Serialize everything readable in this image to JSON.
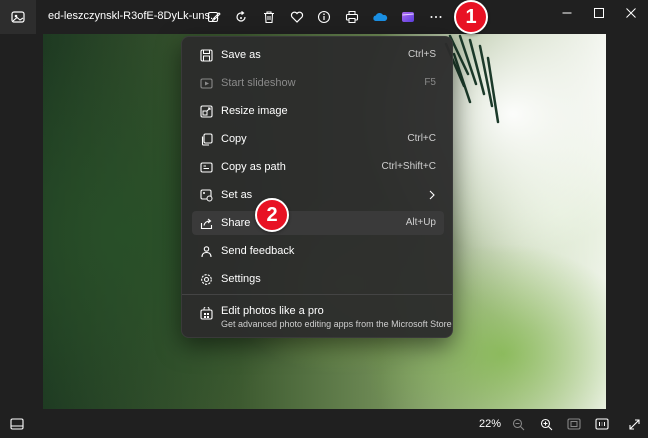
{
  "window": {
    "file_name": "ed-leszczynskl-R3ofE-8DyLk-uns..."
  },
  "toolbar": {
    "icons": [
      "edit-icon",
      "rotate-icon",
      "delete-icon",
      "favorite-icon",
      "info-icon",
      "print-icon",
      "onedrive-icon",
      "clipchamp-icon",
      "more-icon"
    ]
  },
  "menu": {
    "items": [
      {
        "label": "Save as",
        "shortcut": "Ctrl+S",
        "icon": "save-icon",
        "disabled": false
      },
      {
        "label": "Start slideshow",
        "shortcut": "F5",
        "icon": "slideshow-icon",
        "disabled": true
      },
      {
        "label": "Resize image",
        "shortcut": "",
        "icon": "resize-icon",
        "disabled": false
      },
      {
        "label": "Copy",
        "shortcut": "Ctrl+C",
        "icon": "copy-icon",
        "disabled": false
      },
      {
        "label": "Copy as path",
        "shortcut": "Ctrl+Shift+C",
        "icon": "copy-path-icon",
        "disabled": false
      },
      {
        "label": "Set as",
        "shortcut": "",
        "icon": "set-as-icon",
        "disabled": false
      },
      {
        "label": "Share",
        "shortcut": "Alt+Up",
        "icon": "share-icon",
        "disabled": false
      },
      {
        "label": "Send feedback",
        "shortcut": "",
        "icon": "feedback-icon",
        "disabled": false
      },
      {
        "label": "Settings",
        "shortcut": "",
        "icon": "settings-icon",
        "disabled": false
      }
    ],
    "promo": {
      "title": "Edit photos like a pro",
      "subtitle": "Get advanced photo editing apps from the Microsoft Store"
    }
  },
  "markers": {
    "one": "1",
    "two": "2"
  },
  "statusbar": {
    "zoom": "22%"
  },
  "colors": {
    "marker": "#e81224",
    "menu_bg": "#2c2c2c",
    "highlight": "#3a3a3a"
  }
}
